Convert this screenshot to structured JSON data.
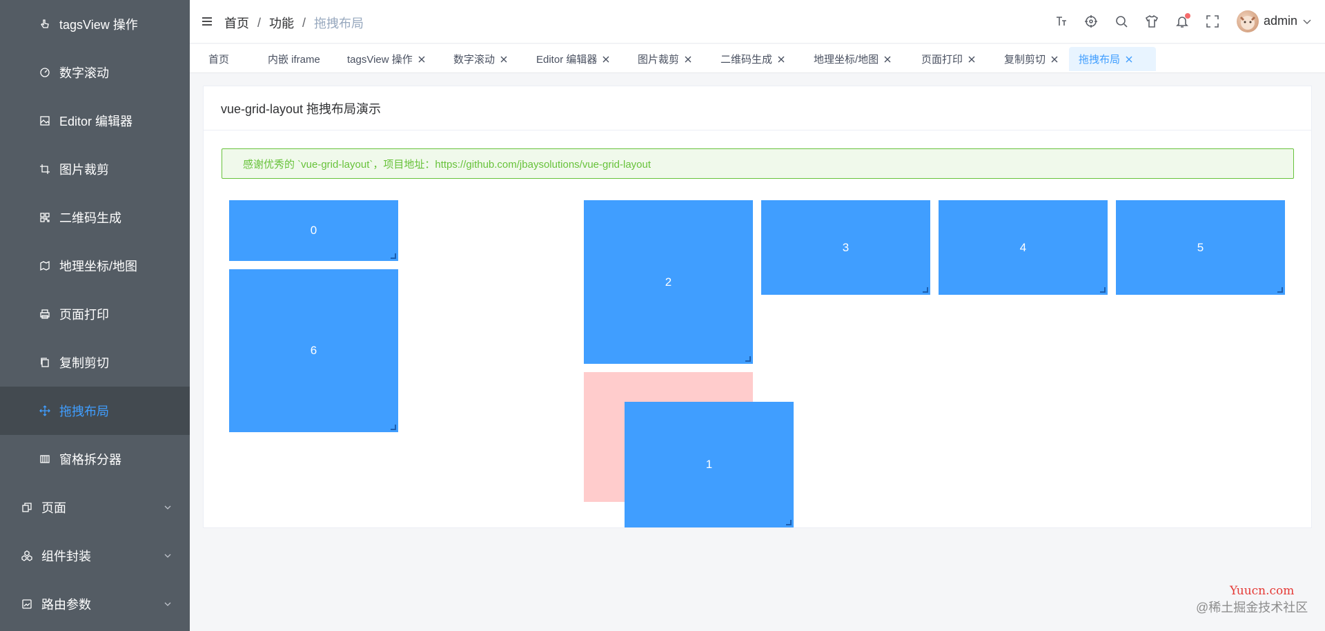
{
  "sidebar": {
    "items": [
      {
        "label": "tagsView 操作",
        "icon": "pointer-icon",
        "type": "sub"
      },
      {
        "label": "数字滚动",
        "icon": "gauge-icon",
        "type": "sub"
      },
      {
        "label": "Editor 编辑器",
        "icon": "picture-icon",
        "type": "sub"
      },
      {
        "label": "图片裁剪",
        "icon": "crop-icon",
        "type": "sub"
      },
      {
        "label": "二维码生成",
        "icon": "qrcode-icon",
        "type": "sub"
      },
      {
        "label": "地理坐标/地图",
        "icon": "map-icon",
        "type": "sub"
      },
      {
        "label": "页面打印",
        "icon": "printer-icon",
        "type": "sub"
      },
      {
        "label": "复制剪切",
        "icon": "copy-icon",
        "type": "sub"
      },
      {
        "label": "拖拽布局",
        "icon": "move-icon",
        "type": "sub",
        "active": true
      },
      {
        "label": "窗格拆分器",
        "icon": "columns-icon",
        "type": "sub"
      },
      {
        "label": "页面",
        "icon": "document-copy-icon",
        "type": "top"
      },
      {
        "label": "组件封装",
        "icon": "cubes-icon",
        "type": "top"
      },
      {
        "label": "路由参数",
        "icon": "image-frame-icon",
        "type": "top"
      }
    ]
  },
  "navbar": {
    "breadcrumb": [
      "首页",
      "功能",
      "拖拽布局"
    ],
    "separator": "/",
    "username": "admin"
  },
  "tags": [
    {
      "label": "首页",
      "closable": false
    },
    {
      "label": "内嵌 iframe",
      "closable": false
    },
    {
      "label": "tagsView 操作",
      "closable": true
    },
    {
      "label": "数字滚动",
      "closable": true
    },
    {
      "label": "Editor 编辑器",
      "closable": true
    },
    {
      "label": "图片裁剪",
      "closable": true
    },
    {
      "label": "二维码生成",
      "closable": true
    },
    {
      "label": "地理坐标/地图",
      "closable": true
    },
    {
      "label": "页面打印",
      "closable": true
    },
    {
      "label": "复制剪切",
      "closable": true
    },
    {
      "label": "拖拽布局",
      "closable": true,
      "active": true
    }
  ],
  "card": {
    "title": "vue-grid-layout 拖拽布局演示",
    "alert": "感谢优秀的 `vue-grid-layout`，项目地址：https://github.com/jbaysolutions/vue-grid-layout"
  },
  "grid_items": [
    "0",
    "6",
    "2",
    "3",
    "4",
    "5",
    "1"
  ],
  "watermark": {
    "site": "Yuucn.com",
    "community": "@稀土掘金技术社区"
  },
  "colors": {
    "sidebar_bg": "#545c64",
    "active_menu_bg": "#434a50",
    "accent": "#409eff",
    "alert_green": "#67c23a",
    "placeholder": "#ffcccc"
  }
}
